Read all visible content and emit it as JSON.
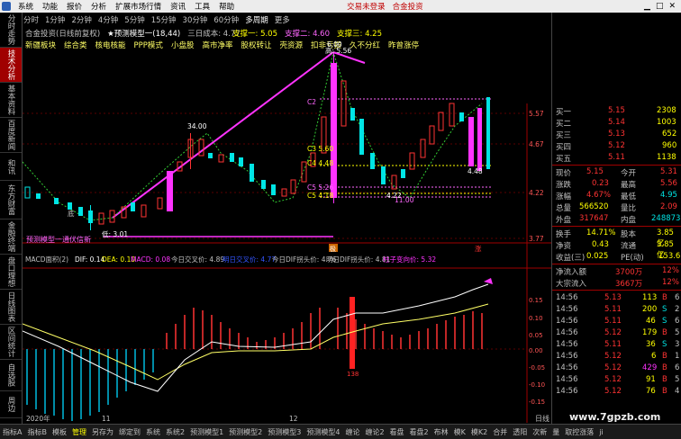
{
  "menubar": {
    "items": [
      "系统",
      "功能",
      "报价",
      "分析",
      "扩展市场行情",
      "资讯",
      "工具",
      "帮助"
    ],
    "login_text": "交易未登录",
    "brand_text": "合金投资"
  },
  "left_tabs": [
    "分时走势",
    "技术分析",
    "基本资料",
    "百度新闻",
    "和讯",
    "东方财富",
    "金融终端",
    "盘口理想",
    "日线图表",
    "区间统计",
    "自选股",
    "周边"
  ],
  "periods": [
    "分时",
    "1分钟",
    "2分钟",
    "4分钟",
    "5分钟",
    "15分钟",
    "30分钟",
    "60分钟",
    "多周期"
  ],
  "periods_more": "更多",
  "kline_header": {
    "name": "合金投资(日线前复权)",
    "indicator": "★预测模型一(18,44)",
    "cost": "三日成本: 4.77",
    "support1": "支撑一: 5.05",
    "support2": "支撑二: 4.60",
    "support3": "支撑三: 4.25"
  },
  "concepts": [
    "新疆板块",
    "综合类",
    "核电核能",
    "PPP模式",
    "小盘股",
    "高市净率",
    "股权转让",
    "壳资源",
    "扣非亏损",
    "久不分红",
    "昨曾涨停"
  ],
  "price_labels": {
    "high_peak": "6.00",
    "high_label": "高: 5.56",
    "mid_high": "34.00",
    "low": "低: 3.01",
    "mid_low": "4.22",
    "low_r": "11.00",
    "c2": "C2",
    "c3": "C3 5.60",
    "c4": "C4 4.48",
    "c5a": "C5 5.26",
    "c5": "C5 4.18",
    "last_price": "4.48",
    "signal_buy": "预测模型一通伏信新",
    "low_signal": "底"
  },
  "y_axis_price": [
    "5.57",
    "4.67",
    "4.22",
    "3.77"
  ],
  "events": {
    "e1": "极",
    "e2": "涨"
  },
  "macd_header": {
    "title": "MACD面积(2)",
    "diff": "DIF: 0.14",
    "dea": "DEA: 0.10",
    "macd": "MACD: 0.08",
    "today_cross": "今日交叉价: 4.89",
    "tomorrow_cross": "明日交叉价: 4.77",
    "today_dif": "今日DIF拐头价: 4.76",
    "tomorrow_dif": "明日DIF拐头价: 4.81",
    "turn_price": "柱子变向价: 5.32"
  },
  "macd_axis": [
    "0.15",
    "0.10",
    "0.05",
    "0.00",
    "-0.05",
    "-0.10",
    "-0.15"
  ],
  "macd_bar_label": "138",
  "date_labels": [
    "2020年",
    "11",
    "12"
  ],
  "order_book": [
    {
      "label": "买一",
      "price": "5.15",
      "vol": "2308"
    },
    {
      "label": "买二",
      "price": "5.14",
      "vol": "1003"
    },
    {
      "label": "买三",
      "price": "5.13",
      "vol": "652"
    },
    {
      "label": "买四",
      "price": "5.12",
      "vol": "960"
    },
    {
      "label": "买五",
      "price": "5.11",
      "vol": "1138"
    }
  ],
  "quote": [
    {
      "l1": "现价",
      "v1": "5.15",
      "l2": "今开",
      "v2": "5.31"
    },
    {
      "l1": "涨跌",
      "v1": "0.23",
      "l2": "最高",
      "v2": "5.56"
    },
    {
      "l1": "涨幅",
      "v1": "4.67%",
      "l2": "最低",
      "v2": "4.95"
    },
    {
      "l1": "总量",
      "v1": "566520",
      "l2": "量比",
      "v2": "2.09"
    },
    {
      "l1": "外盘",
      "v1": "317647",
      "l2": "内盘",
      "v2": "248873"
    }
  ],
  "stats": [
    {
      "l1": "换手",
      "v1": "14.71%",
      "l2": "股本",
      "v2": "3.85亿"
    },
    {
      "l1": "净资",
      "v1": "0.43",
      "l2": "流通",
      "v2": "3.85亿"
    },
    {
      "l1": "收益(三)",
      "v1": "0.025",
      "l2": "PE(动)",
      "v2": "153.6"
    }
  ],
  "flow": [
    {
      "label": "净流入额",
      "value": "3700万",
      "pct": "12%"
    },
    {
      "label": "大宗流入",
      "value": "3667万",
      "pct": "12%"
    }
  ],
  "ticks": [
    {
      "time": "14:56",
      "price": "5.13",
      "vol": "113",
      "side": "B",
      "n": "6"
    },
    {
      "time": "14:56",
      "price": "5.11",
      "vol": "200",
      "side": "S",
      "n": "2"
    },
    {
      "time": "14:56",
      "price": "5.11",
      "vol": "46",
      "side": "S",
      "n": "6"
    },
    {
      "time": "14:56",
      "price": "5.12",
      "vol": "179",
      "side": "B",
      "n": "5"
    },
    {
      "time": "14:56",
      "price": "5.11",
      "vol": "36",
      "side": "S",
      "n": "3"
    },
    {
      "time": "14:56",
      "price": "5.12",
      "vol": "6",
      "side": "B",
      "n": "1"
    },
    {
      "time": "14:56",
      "price": "5.12",
      "vol": "429",
      "side": "B",
      "n": "6"
    },
    {
      "time": "14:56",
      "price": "5.12",
      "vol": "91",
      "side": "B",
      "n": "5"
    },
    {
      "time": "14:56",
      "price": "5.12",
      "vol": "76",
      "side": "B",
      "n": "4"
    }
  ],
  "bottom_tabs": [
    "指标A",
    "指标B",
    "模板",
    "管理",
    "另存为",
    "绑定到",
    "系统",
    "系统2",
    "预测模型1",
    "预测模型2",
    "预测模型3",
    "预测模型4",
    "缠论",
    "缠论2",
    "看盘",
    "看盘2",
    "布林",
    "模K",
    "模K2",
    "合并",
    "透阳",
    "次新",
    "量",
    "取控涨落",
    "ji"
  ],
  "bottom_active": "管理",
  "right_bottom": "日线",
  "watermark": "www.7gpzb.com",
  "colors": {
    "up": "#ff3333",
    "down": "#00e5e5",
    "magenta": "#ff33ff",
    "yellow": "#ffff00",
    "white": "#ffffff"
  }
}
